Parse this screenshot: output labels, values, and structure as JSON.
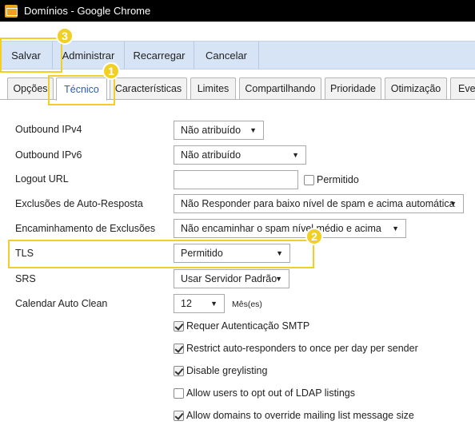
{
  "window": {
    "title": "Domínios - Google Chrome"
  },
  "toolbar": {
    "save": "Salvar",
    "admin": "Administrar",
    "reload": "Recarregar",
    "cancel": "Cancelar"
  },
  "tabs": [
    "Opções",
    "Técnico",
    "Características",
    "Limites",
    "Compartilhando",
    "Prioridade",
    "Otimização",
    "Eve"
  ],
  "active_tab": "Técnico",
  "form": {
    "ipv4": {
      "label": "Outbound IPv4",
      "value": "Não atribuído"
    },
    "ipv6": {
      "label": "Outbound IPv6",
      "value": "Não atribuído"
    },
    "logout": {
      "label": "Logout URL",
      "value": "",
      "checkbox_label": "Permitido"
    },
    "autoresp": {
      "label": "Exclusões de Auto-Resposta",
      "value": "Não Responder para baixo nível de spam e acima automática"
    },
    "forward": {
      "label": "Encaminhamento de Exclusões",
      "value": "Não encaminhar o spam nível médio e acima"
    },
    "tls": {
      "label": "TLS",
      "value": "Permitido"
    },
    "srs": {
      "label": "SRS",
      "value": "Usar Servidor Padrão"
    },
    "clean": {
      "label": "Calendar Auto Clean",
      "value": "12",
      "unit": "Mês(es)"
    }
  },
  "checkboxes": [
    {
      "label": "Requer Autenticação SMTP",
      "checked": true
    },
    {
      "label": "Restrict auto-responders to once per day per sender",
      "checked": true
    },
    {
      "label": "Disable greylisting",
      "checked": true
    },
    {
      "label": "Allow users to opt out of LDAP listings",
      "checked": false
    },
    {
      "label": "Allow domains to override mailing list message size",
      "checked": true
    }
  ],
  "annotations": [
    "1",
    "2",
    "3"
  ],
  "colors": {
    "highlight": "#f2cf27",
    "toolbar": "#d6e4f6",
    "active_tab_text": "#2a5db0"
  }
}
